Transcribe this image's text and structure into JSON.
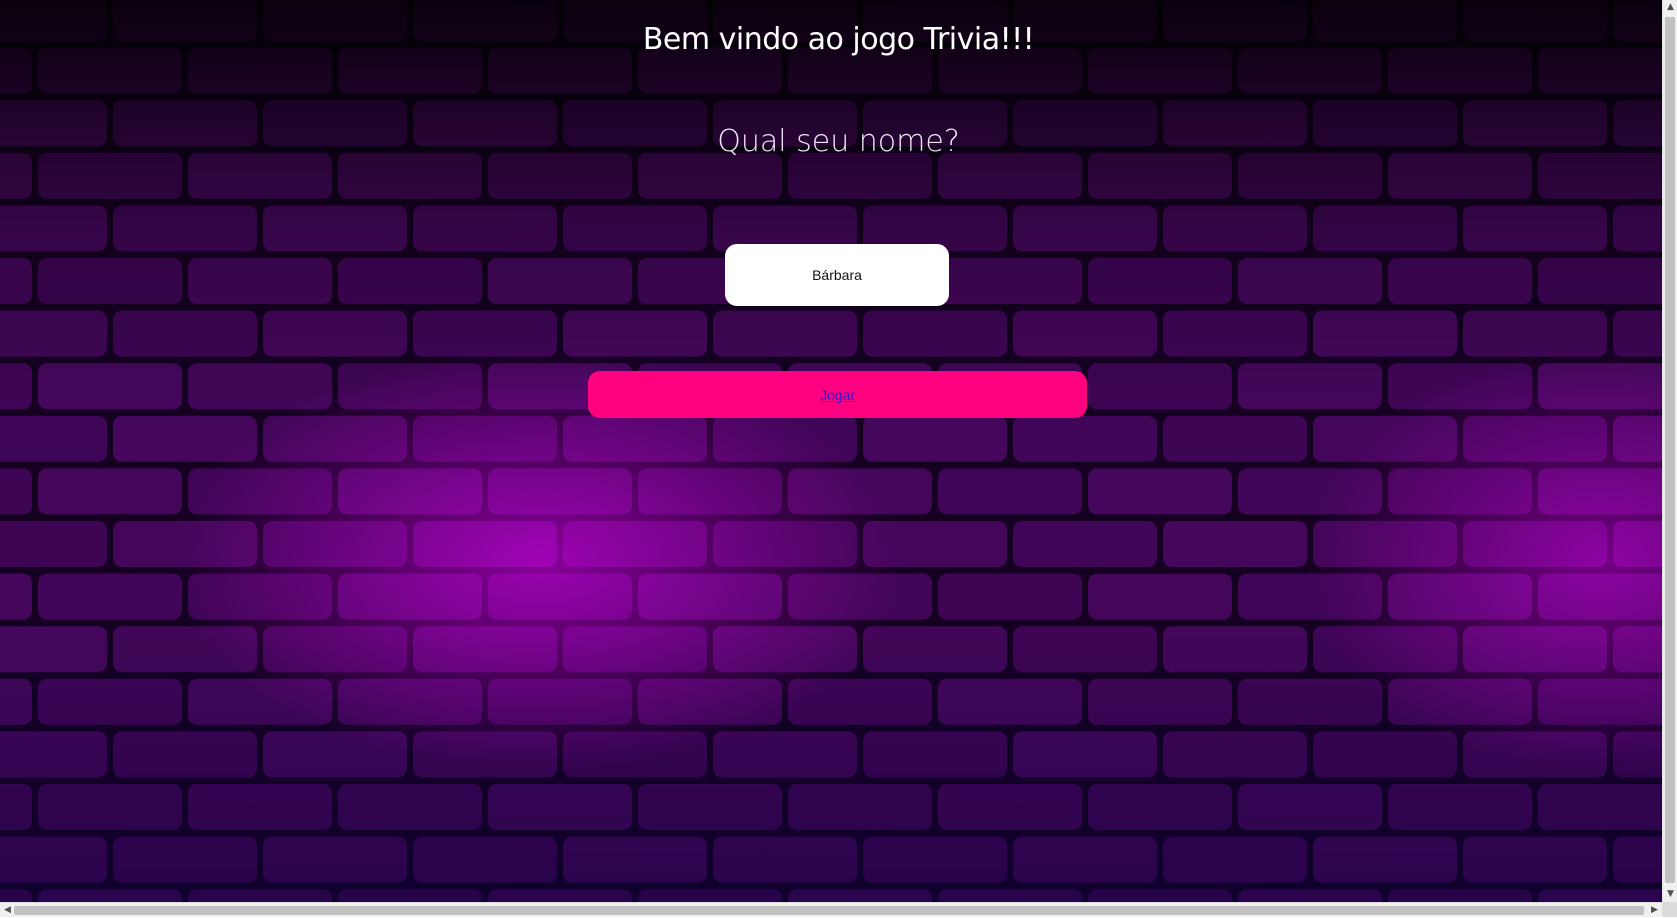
{
  "page": {
    "title": "Bem vindo ao jogo Trivia!!!",
    "question": "Qual seu nome?"
  },
  "form": {
    "name_value": "Bárbara",
    "play_label": "Jogar"
  },
  "colors": {
    "accent": "#ff0080",
    "link": "#2a1bd6",
    "background": "#150022",
    "glow": "#eb00ff"
  },
  "icons": {
    "scroll_up": "triangle-up",
    "scroll_down": "triangle-down",
    "scroll_left": "triangle-left",
    "scroll_right": "triangle-right"
  }
}
